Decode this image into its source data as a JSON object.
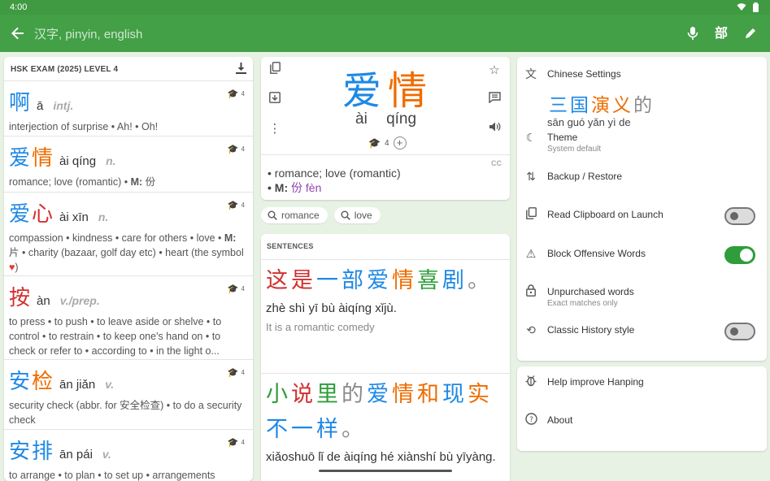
{
  "status": {
    "time": "4:00",
    "icons": [
      "wifi-icon",
      "battery-icon"
    ]
  },
  "appbar": {
    "back_icon": "arrow-back-icon",
    "search_placeholder": "汉字, pinyin, english",
    "mic_icon": "mic-icon",
    "radical_label": "部",
    "handwriting_icon": "pencil-icon"
  },
  "colors": {
    "tone1": "#d32f2f",
    "tone2": "#ef6c00",
    "tone3": "#2e9d3a",
    "tone4": "#1e88e5",
    "neutral": "#8a8a8a",
    "appbar": "#43a047"
  },
  "list": {
    "title": "HSK EXAM (2025) LEVEL 4",
    "download_icon": "download-icon",
    "entries": [
      {
        "hanzi": "啊",
        "pinyin": "ā",
        "pos": "intj.",
        "level": "4",
        "def": "interjection of surprise • Ah! • Oh!"
      },
      {
        "hanzi": "爱情",
        "pinyin": "ài qíng",
        "pos": "n.",
        "level": "4",
        "def_main": "romance; love (romantic) • ",
        "def_m_label": "M:",
        "def_m_value": " 份"
      },
      {
        "hanzi": "爱心",
        "pinyin": "ài xīn",
        "pos": "n.",
        "level": "4",
        "def_a": "compassion • kindness • care for others • love • ",
        "def_m_label": "M:",
        "def_b": " 片 • charity (bazaar, golf day etc) • heart (the symbol ",
        "def_heart": "♥",
        "def_c": ")"
      },
      {
        "hanzi": "按",
        "pinyin": "àn",
        "pos": "v./prep.",
        "level": "4",
        "def": "to press • to push • to leave aside or shelve • to control • to restrain • to keep one's hand on • to check or refer to • according to • in the light o..."
      },
      {
        "hanzi": "安检",
        "pinyin": "ān jiǎn",
        "pos": "v.",
        "level": "4",
        "def": "security check (abbr. for 安全检查) • to do a security check"
      },
      {
        "hanzi": "安排",
        "pinyin": "ān pái",
        "pos": "v.",
        "level": "4",
        "def": "to arrange • to plan • to set up • arrangements"
      }
    ]
  },
  "word": {
    "hanzi_1": "爱",
    "hanzi_2": "情",
    "pinyin_1": "ài",
    "pinyin_2": "qíng",
    "level": "4",
    "plus": "+",
    "source": "CC",
    "def_line1": "• romance; love (romantic)",
    "def_m_label": "• M:",
    "def_m_value": "份 fèn",
    "icons": [
      "copy-icon",
      "open-in-icon",
      "more-icon",
      "star-icon",
      "notes-icon",
      "speaker-icon"
    ]
  },
  "chips": [
    {
      "label": "romance",
      "icon": "search-icon"
    },
    {
      "label": "love",
      "icon": "search-icon"
    }
  ],
  "sentences": {
    "title": "SENTENCES",
    "items": [
      {
        "pinyin": "zhè shì yī bù àiqíng xǐjù.",
        "english": "It is a romantic comedy"
      },
      {
        "pinyin": "xiǎoshuō lǐ de àiqíng hé xiànshí bù yīyàng."
      }
    ]
  },
  "settings": {
    "chinese": {
      "label": "Chinese Settings",
      "sample_pinyin": "sān guó yǎn yì de",
      "icon": "translate-icon"
    },
    "theme": {
      "label": "Theme",
      "sub": "System default",
      "icon": "moon-icon"
    },
    "backup": {
      "label": "Backup / Restore",
      "icon": "swap-vertical-icon"
    },
    "clipboard": {
      "label": "Read Clipboard on Launch",
      "on": false,
      "icon": "clipboard-icon"
    },
    "offensive": {
      "label": "Block Offensive Words",
      "on": true,
      "icon": "warning-icon"
    },
    "unpurchased": {
      "label": "Unpurchased words",
      "sub": "Exact matches only",
      "icon": "lock-icon"
    },
    "history": {
      "label": "Classic History style",
      "on": false,
      "icon": "history-icon"
    }
  },
  "help": {
    "improve": {
      "label": "Help improve Hanping",
      "icon": "bug-icon"
    },
    "about": {
      "label": "About",
      "icon": "help-circle-icon"
    }
  }
}
